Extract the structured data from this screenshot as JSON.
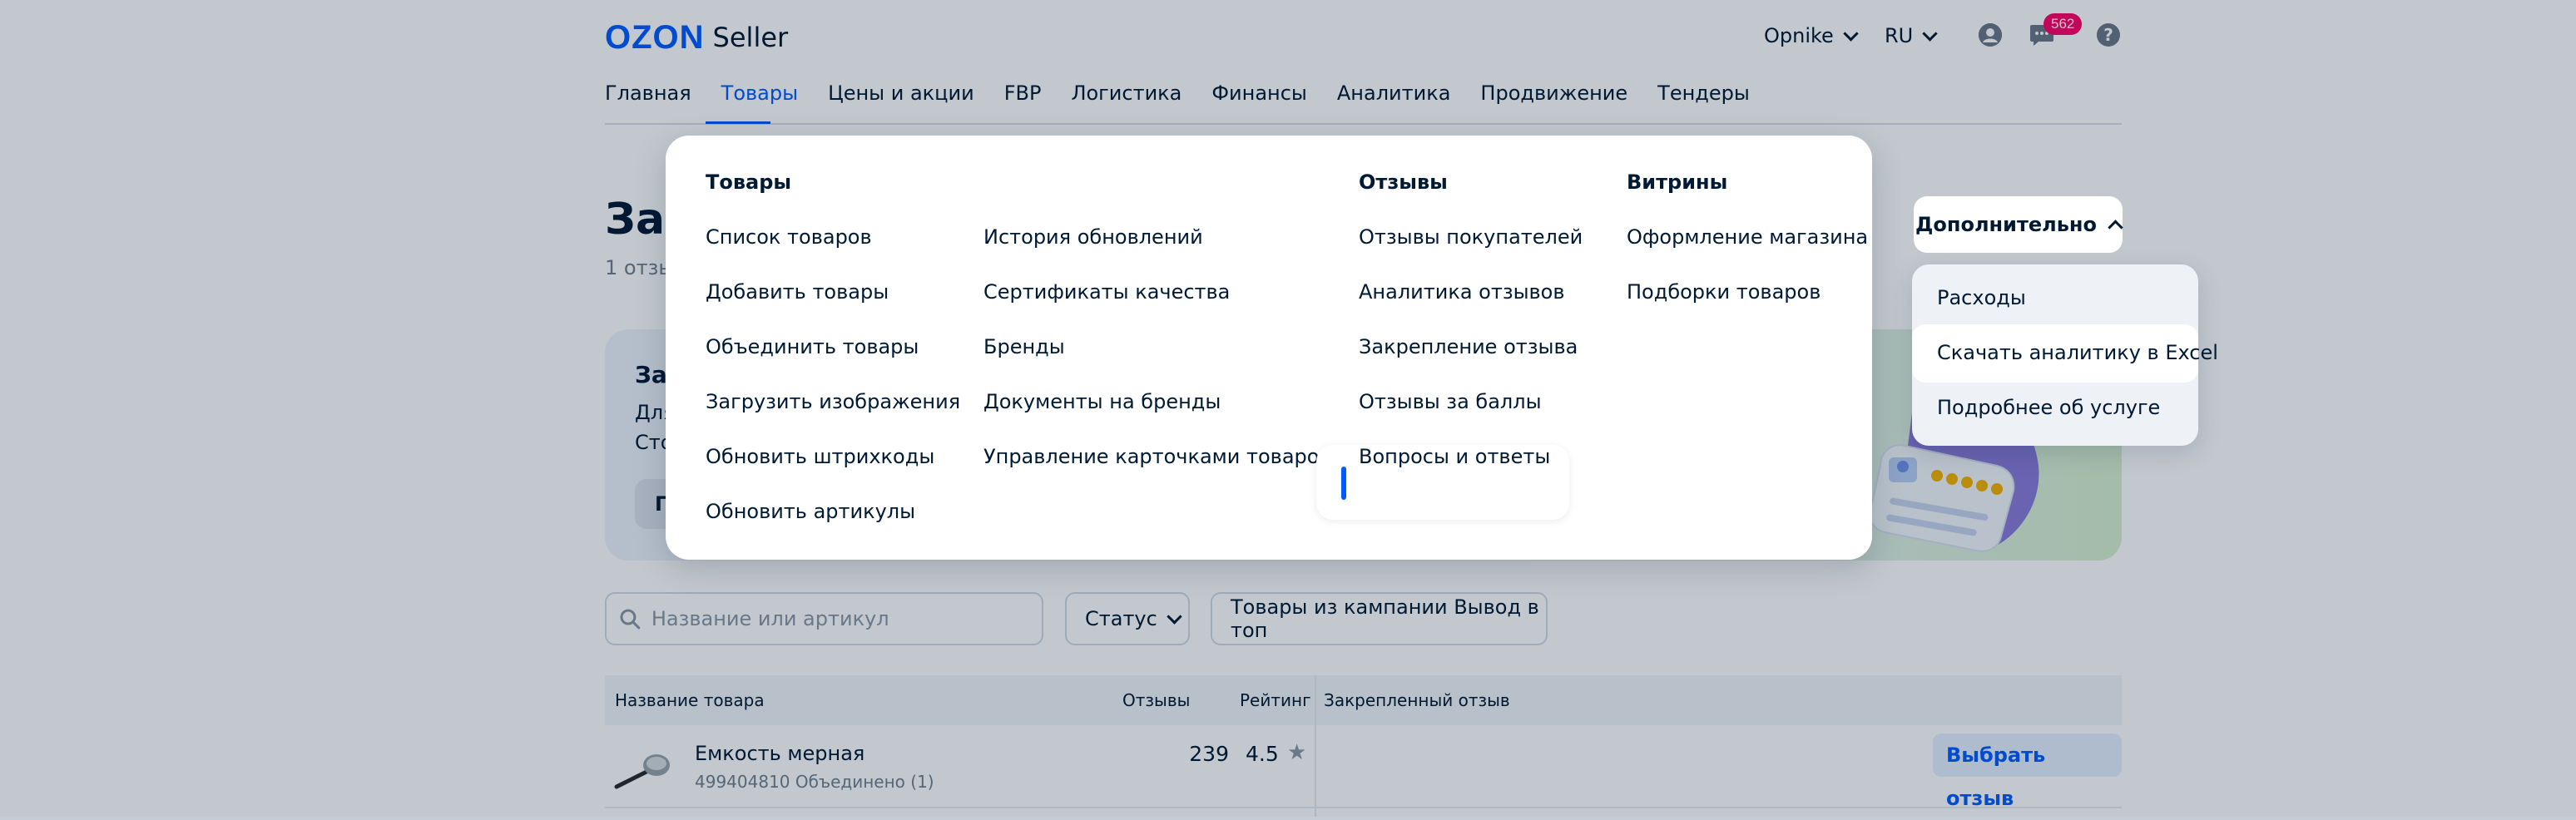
{
  "header": {
    "logo_brand": "OZON",
    "logo_product": "Seller",
    "account": "Opnike",
    "language": "RU",
    "messages_count": "562",
    "help_glyph": "?"
  },
  "nav": {
    "tabs": [
      "Главная",
      "Товары",
      "Цены и акции",
      "FBP",
      "Логистика",
      "Финансы",
      "Аналитика",
      "Продвижение",
      "Тендеры"
    ],
    "active": "Товары"
  },
  "page": {
    "title_partial": "Зак",
    "subtitle_partial": "1 отзы"
  },
  "promo": {
    "title_partial": "Зак",
    "line1_partial": "Для",
    "line2_partial": "Сто",
    "button_partial": "П"
  },
  "mega_menu": {
    "products": {
      "title": "Товары",
      "col1": [
        "Список товаров",
        "Добавить товары",
        "Объединить товары",
        "Загрузить изображения",
        "Обновить штрихкоды",
        "Обновить артикулы"
      ],
      "col2": [
        "История обновлений",
        "Сертификаты качества",
        "Бренды",
        "Документы на бренды",
        "Управление карточками товаров"
      ]
    },
    "reviews": {
      "title": "Отзывы",
      "items": [
        "Отзывы покупателей",
        "Аналитика отзывов",
        "Закрепление отзыва",
        "Отзывы за баллы",
        "Вопросы и ответы"
      ],
      "selected": "Закрепление отзыва"
    },
    "showcases": {
      "title": "Витрины",
      "items": [
        "Оформление магазина",
        "Подборки товаров"
      ]
    }
  },
  "more": {
    "label": "Дополнительно",
    "items": [
      "Расходы",
      "Скачать аналитику в Excel",
      "Подробнее об услуге"
    ],
    "hovered": "Скачать аналитику в Excel"
  },
  "filters": {
    "search_placeholder": "Название или артикул",
    "status_label": "Статус",
    "campaign_label": "Товары из кампании Вывод в топ"
  },
  "table": {
    "headers": {
      "name": "Название товара",
      "reviews": "Отзывы",
      "rating": "Рейтинг",
      "pinned": "Закрепленный отзыв"
    },
    "rows": [
      {
        "name": "Емкость мерная",
        "sub": "499404810 Объединено (1)",
        "reviews": "239",
        "rating": "4.5",
        "action": "Выбрать отзыв"
      }
    ]
  },
  "colors": {
    "accent": "#005bff",
    "badge": "#ff0066",
    "text": "#001a34",
    "muted": "#707f8d"
  }
}
